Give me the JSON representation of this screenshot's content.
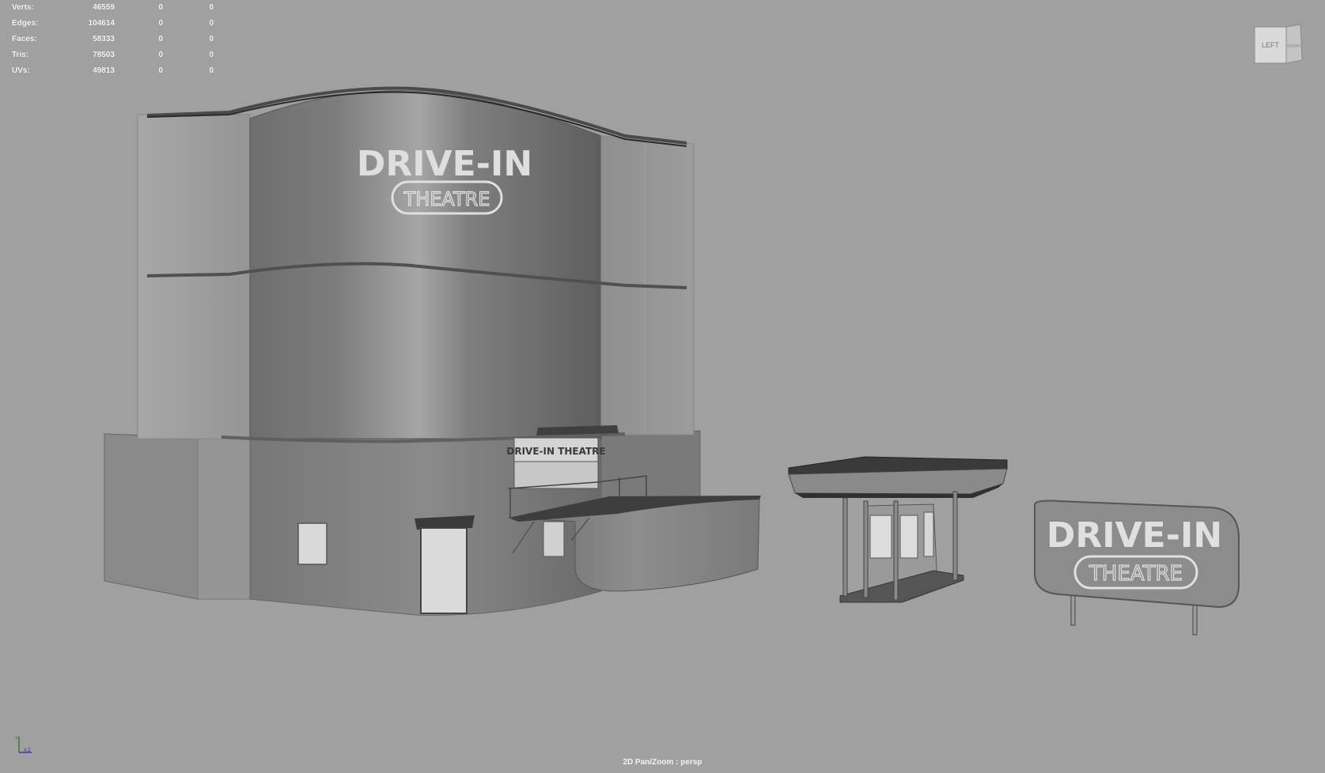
{
  "hud": {
    "rows": [
      {
        "label": "Verts:",
        "v1": "46559",
        "v2": "0",
        "v3": "0"
      },
      {
        "label": "Edges:",
        "v1": "104614",
        "v2": "0",
        "v3": "0"
      },
      {
        "label": "Faces:",
        "v1": "58333",
        "v2": "0",
        "v3": "0"
      },
      {
        "label": "Tris:",
        "v1": "78503",
        "v2": "0",
        "v3": "0"
      },
      {
        "label": "UVs:",
        "v1": "49813",
        "v2": "0",
        "v3": "0"
      }
    ]
  },
  "viewcube": {
    "left_face": "LEFT",
    "front_face": "FRONT"
  },
  "status": {
    "camera_label": "2D Pan/Zoom : persp"
  },
  "axis": {
    "y": "Y",
    "x": "X",
    "z": "Z"
  },
  "scene": {
    "tower_sign_main": "DRIVE-IN",
    "tower_sign_sub": "THEATRE",
    "booth_banner": "DRIVE-IN THEATRE",
    "billboard_main": "DRIVE-IN",
    "billboard_sub": "THEATRE"
  },
  "colors": {
    "background": "#a0a0a0",
    "hud_text": "#f4f4f4"
  }
}
